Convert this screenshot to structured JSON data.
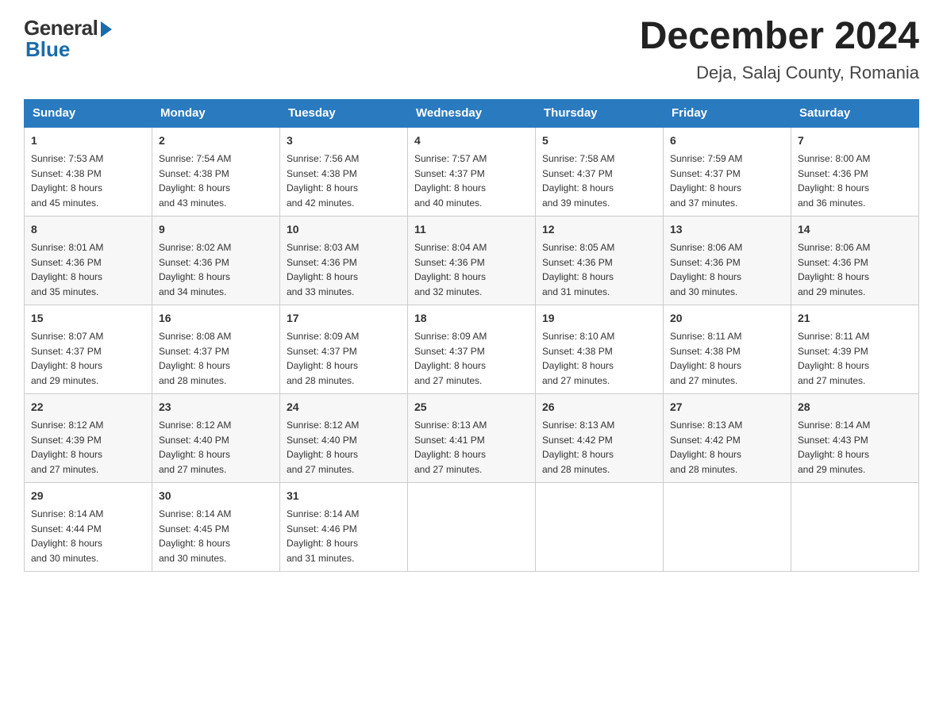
{
  "header": {
    "logo_general": "General",
    "logo_blue": "Blue",
    "month_title": "December 2024",
    "location": "Deja, Salaj County, Romania"
  },
  "days_of_week": [
    "Sunday",
    "Monday",
    "Tuesday",
    "Wednesday",
    "Thursday",
    "Friday",
    "Saturday"
  ],
  "weeks": [
    [
      {
        "day": "1",
        "sunrise": "7:53 AM",
        "sunset": "4:38 PM",
        "daylight": "8 hours and 45 minutes."
      },
      {
        "day": "2",
        "sunrise": "7:54 AM",
        "sunset": "4:38 PM",
        "daylight": "8 hours and 43 minutes."
      },
      {
        "day": "3",
        "sunrise": "7:56 AM",
        "sunset": "4:38 PM",
        "daylight": "8 hours and 42 minutes."
      },
      {
        "day": "4",
        "sunrise": "7:57 AM",
        "sunset": "4:37 PM",
        "daylight": "8 hours and 40 minutes."
      },
      {
        "day": "5",
        "sunrise": "7:58 AM",
        "sunset": "4:37 PM",
        "daylight": "8 hours and 39 minutes."
      },
      {
        "day": "6",
        "sunrise": "7:59 AM",
        "sunset": "4:37 PM",
        "daylight": "8 hours and 37 minutes."
      },
      {
        "day": "7",
        "sunrise": "8:00 AM",
        "sunset": "4:36 PM",
        "daylight": "8 hours and 36 minutes."
      }
    ],
    [
      {
        "day": "8",
        "sunrise": "8:01 AM",
        "sunset": "4:36 PM",
        "daylight": "8 hours and 35 minutes."
      },
      {
        "day": "9",
        "sunrise": "8:02 AM",
        "sunset": "4:36 PM",
        "daylight": "8 hours and 34 minutes."
      },
      {
        "day": "10",
        "sunrise": "8:03 AM",
        "sunset": "4:36 PM",
        "daylight": "8 hours and 33 minutes."
      },
      {
        "day": "11",
        "sunrise": "8:04 AM",
        "sunset": "4:36 PM",
        "daylight": "8 hours and 32 minutes."
      },
      {
        "day": "12",
        "sunrise": "8:05 AM",
        "sunset": "4:36 PM",
        "daylight": "8 hours and 31 minutes."
      },
      {
        "day": "13",
        "sunrise": "8:06 AM",
        "sunset": "4:36 PM",
        "daylight": "8 hours and 30 minutes."
      },
      {
        "day": "14",
        "sunrise": "8:06 AM",
        "sunset": "4:36 PM",
        "daylight": "8 hours and 29 minutes."
      }
    ],
    [
      {
        "day": "15",
        "sunrise": "8:07 AM",
        "sunset": "4:37 PM",
        "daylight": "8 hours and 29 minutes."
      },
      {
        "day": "16",
        "sunrise": "8:08 AM",
        "sunset": "4:37 PM",
        "daylight": "8 hours and 28 minutes."
      },
      {
        "day": "17",
        "sunrise": "8:09 AM",
        "sunset": "4:37 PM",
        "daylight": "8 hours and 28 minutes."
      },
      {
        "day": "18",
        "sunrise": "8:09 AM",
        "sunset": "4:37 PM",
        "daylight": "8 hours and 27 minutes."
      },
      {
        "day": "19",
        "sunrise": "8:10 AM",
        "sunset": "4:38 PM",
        "daylight": "8 hours and 27 minutes."
      },
      {
        "day": "20",
        "sunrise": "8:11 AM",
        "sunset": "4:38 PM",
        "daylight": "8 hours and 27 minutes."
      },
      {
        "day": "21",
        "sunrise": "8:11 AM",
        "sunset": "4:39 PM",
        "daylight": "8 hours and 27 minutes."
      }
    ],
    [
      {
        "day": "22",
        "sunrise": "8:12 AM",
        "sunset": "4:39 PM",
        "daylight": "8 hours and 27 minutes."
      },
      {
        "day": "23",
        "sunrise": "8:12 AM",
        "sunset": "4:40 PM",
        "daylight": "8 hours and 27 minutes."
      },
      {
        "day": "24",
        "sunrise": "8:12 AM",
        "sunset": "4:40 PM",
        "daylight": "8 hours and 27 minutes."
      },
      {
        "day": "25",
        "sunrise": "8:13 AM",
        "sunset": "4:41 PM",
        "daylight": "8 hours and 27 minutes."
      },
      {
        "day": "26",
        "sunrise": "8:13 AM",
        "sunset": "4:42 PM",
        "daylight": "8 hours and 28 minutes."
      },
      {
        "day": "27",
        "sunrise": "8:13 AM",
        "sunset": "4:42 PM",
        "daylight": "8 hours and 28 minutes."
      },
      {
        "day": "28",
        "sunrise": "8:14 AM",
        "sunset": "4:43 PM",
        "daylight": "8 hours and 29 minutes."
      }
    ],
    [
      {
        "day": "29",
        "sunrise": "8:14 AM",
        "sunset": "4:44 PM",
        "daylight": "8 hours and 30 minutes."
      },
      {
        "day": "30",
        "sunrise": "8:14 AM",
        "sunset": "4:45 PM",
        "daylight": "8 hours and 30 minutes."
      },
      {
        "day": "31",
        "sunrise": "8:14 AM",
        "sunset": "4:46 PM",
        "daylight": "8 hours and 31 minutes."
      },
      null,
      null,
      null,
      null
    ]
  ],
  "labels": {
    "sunrise": "Sunrise:",
    "sunset": "Sunset:",
    "daylight": "Daylight:"
  }
}
